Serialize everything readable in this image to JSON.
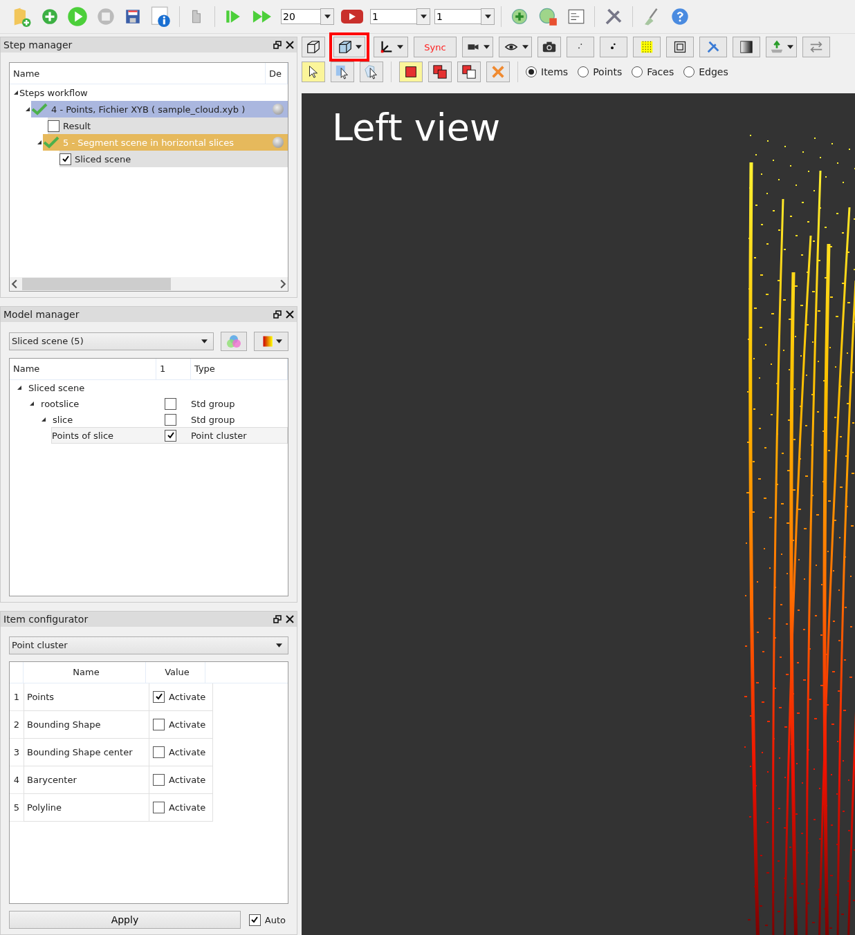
{
  "toolbar": {
    "spin_fields": [
      "20",
      "1",
      "1"
    ]
  },
  "view_toolbar": {
    "sync_label": "Sync",
    "view_mode_highlighted": true,
    "selection_modes": [
      {
        "label": "Items",
        "selected": true
      },
      {
        "label": "Points",
        "selected": false
      },
      {
        "label": "Faces",
        "selected": false
      },
      {
        "label": "Edges",
        "selected": false
      }
    ]
  },
  "step_manager": {
    "title": "Step manager",
    "columns": [
      "Name",
      "De"
    ],
    "tree": [
      {
        "kind": "group",
        "label": "Steps workflow",
        "expanded": true,
        "children": [
          {
            "kind": "step",
            "label": "4 - Points, Fichier XYB ( sample_cloud.xyb )",
            "expanded": true,
            "selected": true,
            "active": false,
            "children": [
              {
                "kind": "result",
                "label": "Result",
                "checked": false
              },
              {
                "kind": "step",
                "label": "5 - Segment scene in horizontal slices",
                "expanded": true,
                "selected": false,
                "active": true,
                "children": [
                  {
                    "kind": "result",
                    "label": "Sliced scene",
                    "checked": true
                  }
                ]
              }
            ]
          }
        ]
      }
    ]
  },
  "model_manager": {
    "title": "Model manager",
    "combo": "Sliced scene (5)",
    "columns": [
      "Name",
      "1",
      "Type"
    ],
    "tree": [
      {
        "kind": "root",
        "label": "Sliced scene",
        "expanded": true,
        "children": [
          {
            "kind": "item",
            "label": "rootslice",
            "checked": false,
            "type": "Std group",
            "selected": false,
            "expanded": true,
            "children": [
              {
                "kind": "item",
                "label": "slice",
                "checked": false,
                "type": "Std group",
                "selected": false,
                "expanded": true,
                "children": [
                  {
                    "kind": "item",
                    "label": "Points of slice",
                    "checked": true,
                    "type": "Point cluster",
                    "selected": true
                  }
                ]
              }
            ]
          }
        ]
      }
    ]
  },
  "item_configurator": {
    "title": "Item configurator",
    "combo": "Point cluster",
    "columns": [
      "Name",
      "Value"
    ],
    "rows": [
      {
        "index": "1",
        "name": "Points",
        "value": "Activate",
        "checked": true
      },
      {
        "index": "2",
        "name": "Bounding Shape",
        "value": "Activate",
        "checked": false
      },
      {
        "index": "3",
        "name": "Bounding Shape center",
        "value": "Activate",
        "checked": false
      },
      {
        "index": "4",
        "name": "Barycenter",
        "value": "Activate",
        "checked": false
      },
      {
        "index": "5",
        "name": "Polyline",
        "value": "Activate",
        "checked": false
      }
    ],
    "apply": "Apply",
    "auto": {
      "label": "Auto",
      "checked": true
    }
  },
  "viewport": {
    "title": "Left view"
  }
}
